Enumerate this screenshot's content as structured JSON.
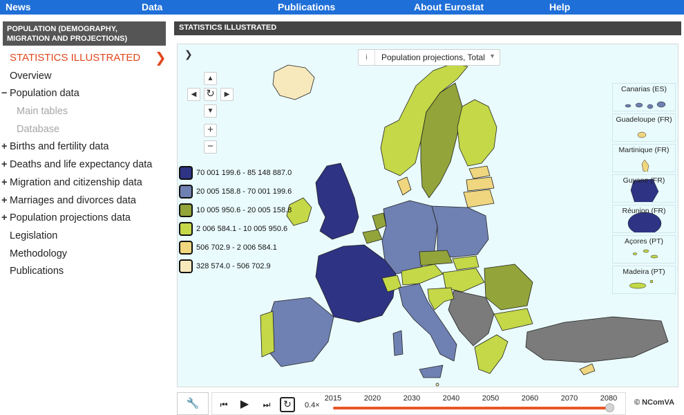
{
  "topnav": {
    "items": [
      "News",
      "Data",
      "Publications",
      "About Eurostat",
      "Help"
    ]
  },
  "sidebar": {
    "header": "POPULATION (DEMOGRAPHY, MIGRATION AND PROJECTIONS)",
    "items": [
      {
        "label": "STATISTICS ILLUSTRATED",
        "state": "active"
      },
      {
        "label": "Overview"
      },
      {
        "label": "Population data",
        "prefix": "−"
      },
      {
        "label": "Main tables",
        "state": "sub"
      },
      {
        "label": "Database",
        "state": "sub"
      },
      {
        "label": "Births and fertility data",
        "prefix": "+"
      },
      {
        "label": "Deaths and life expectancy data",
        "prefix": "+"
      },
      {
        "label": "Migration and citizenship data",
        "prefix": "+"
      },
      {
        "label": "Marriages and divorces data",
        "prefix": "+"
      },
      {
        "label": "Population projections data",
        "prefix": "+"
      },
      {
        "label": "Legislation"
      },
      {
        "label": "Methodology"
      },
      {
        "label": "Publications"
      }
    ],
    "active_chevron": "❯"
  },
  "main": {
    "header": "STATISTICS ILLUSTRATED",
    "expand_icon": "❯",
    "dropdown": {
      "info": "i",
      "value": "Population projections, Total",
      "caret": "▼"
    },
    "pan": {
      "up": "▲",
      "left": "◀",
      "reset": "↻",
      "right": "▶",
      "down": "▼"
    },
    "zoom": {
      "in": "+",
      "out": "−"
    },
    "legend": [
      {
        "label": "70 001 199.6 - 85 148 887.0",
        "color": "#2e3383"
      },
      {
        "label": "20 005 158.8 - 70 001 199.6",
        "color": "#6f80b2"
      },
      {
        "label": "10 005 950.6 - 20 005 158.8",
        "color": "#93a43a"
      },
      {
        "label": "2 006 584.1 - 10 005 950.6",
        "color": "#c4d848"
      },
      {
        "label": "506 702.9 - 2 006 584.1",
        "color": "#efd67f"
      },
      {
        "label": "328 574.0 - 506 702.9",
        "color": "#f8e9bd"
      }
    ],
    "no_data_color": "#7b7b7b",
    "sea_color": "#eafbfd",
    "insets": [
      {
        "label": "Canarias (ES)"
      },
      {
        "label": "Guadeloupe (FR)"
      },
      {
        "label": "Martinique (FR)"
      },
      {
        "label": "Guyane (FR)"
      },
      {
        "label": "Réunion (FR)"
      },
      {
        "label": "Açores (PT)"
      },
      {
        "label": "Madeira (PT)"
      }
    ]
  },
  "player": {
    "tool_icon": "🔧",
    "first": "⏮",
    "play": "▶",
    "last": "⏭",
    "loop": "↻",
    "speed": "0.4×",
    "years": [
      "2015",
      "2020",
      "2030",
      "2040",
      "2050",
      "2060",
      "2070",
      "2080"
    ],
    "selected_year": "2080"
  },
  "credit": "© NComVA"
}
